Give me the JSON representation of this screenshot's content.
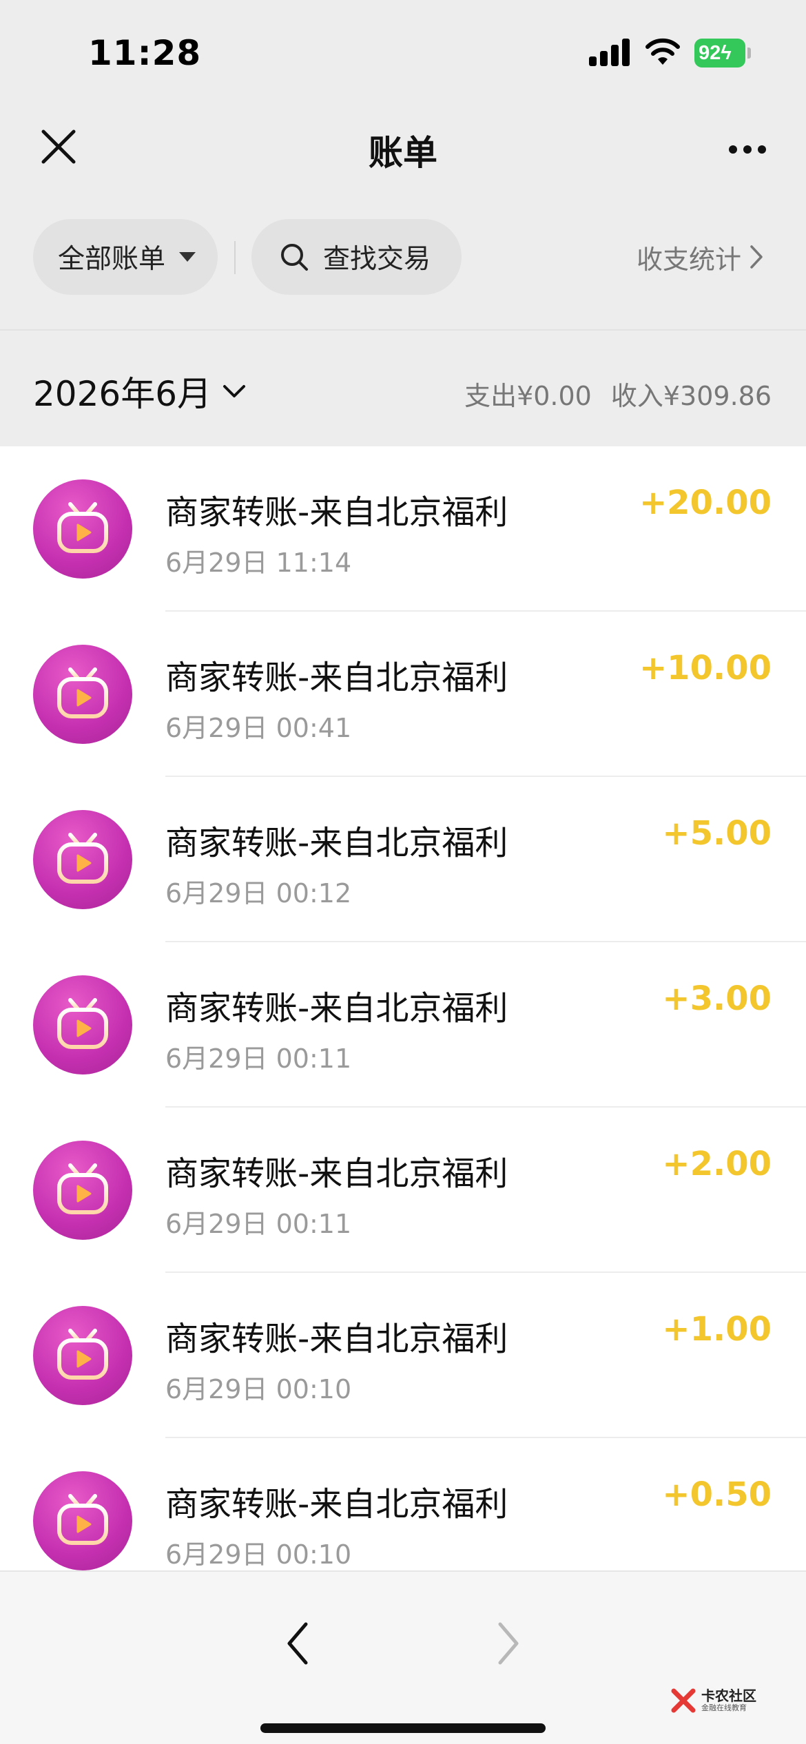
{
  "status_bar": {
    "time": "11:28",
    "battery": "92"
  },
  "nav": {
    "title": "账单"
  },
  "filters": {
    "all_bills": "全部账单",
    "search": "查找交易",
    "stats": "收支统计"
  },
  "month": {
    "label": "2026年6月",
    "expense": "支出¥0.00",
    "income": "收入¥309.86"
  },
  "transactions": [
    {
      "title": "商家转账-来自北京福利",
      "time": "6月29日 11:14",
      "amount": "+20.00"
    },
    {
      "title": "商家转账-来自北京福利",
      "time": "6月29日 00:41",
      "amount": "+10.00"
    },
    {
      "title": "商家转账-来自北京福利",
      "time": "6月29日 00:12",
      "amount": "+5.00"
    },
    {
      "title": "商家转账-来自北京福利",
      "time": "6月29日 00:11",
      "amount": "+3.00"
    },
    {
      "title": "商家转账-来自北京福利",
      "time": "6月29日 00:11",
      "amount": "+2.00"
    },
    {
      "title": "商家转账-来自北京福利",
      "time": "6月29日 00:10",
      "amount": "+1.00"
    },
    {
      "title": "商家转账-来自北京福利",
      "time": "6月29日 00:10",
      "amount": "+0.50"
    }
  ],
  "watermark": {
    "main": "卡农社区",
    "sub": "金融在线教育"
  },
  "colors": {
    "amount": "#f3c62e",
    "avatar": "#c42fb0",
    "battery": "#34c759"
  }
}
